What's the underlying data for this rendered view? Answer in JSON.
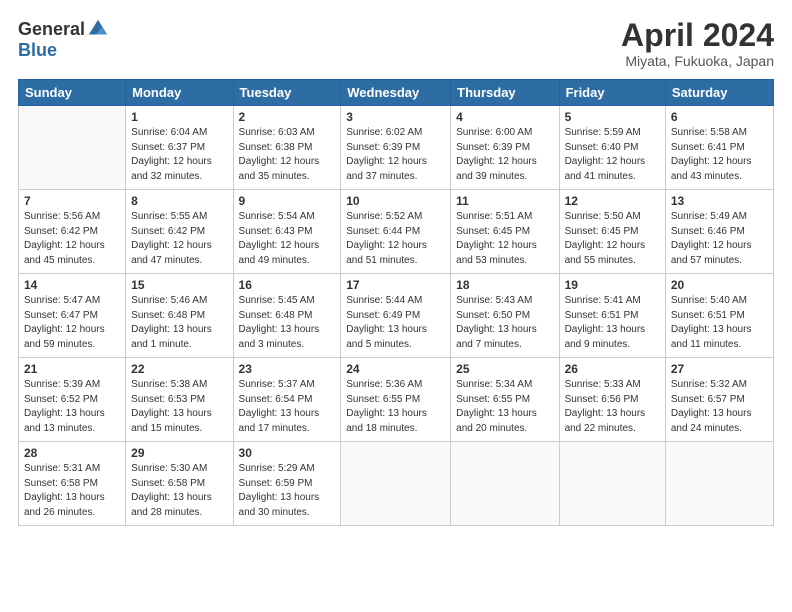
{
  "header": {
    "logo_general": "General",
    "logo_blue": "Blue",
    "title": "April 2024",
    "location": "Miyata, Fukuoka, Japan"
  },
  "weekdays": [
    "Sunday",
    "Monday",
    "Tuesday",
    "Wednesday",
    "Thursday",
    "Friday",
    "Saturday"
  ],
  "weeks": [
    [
      {
        "day": "",
        "empty": true
      },
      {
        "day": "1",
        "sunrise": "6:04 AM",
        "sunset": "6:37 PM",
        "daylight": "12 hours and 32 minutes."
      },
      {
        "day": "2",
        "sunrise": "6:03 AM",
        "sunset": "6:38 PM",
        "daylight": "12 hours and 35 minutes."
      },
      {
        "day": "3",
        "sunrise": "6:02 AM",
        "sunset": "6:39 PM",
        "daylight": "12 hours and 37 minutes."
      },
      {
        "day": "4",
        "sunrise": "6:00 AM",
        "sunset": "6:39 PM",
        "daylight": "12 hours and 39 minutes."
      },
      {
        "day": "5",
        "sunrise": "5:59 AM",
        "sunset": "6:40 PM",
        "daylight": "12 hours and 41 minutes."
      },
      {
        "day": "6",
        "sunrise": "5:58 AM",
        "sunset": "6:41 PM",
        "daylight": "12 hours and 43 minutes."
      }
    ],
    [
      {
        "day": "7",
        "sunrise": "5:56 AM",
        "sunset": "6:42 PM",
        "daylight": "12 hours and 45 minutes."
      },
      {
        "day": "8",
        "sunrise": "5:55 AM",
        "sunset": "6:42 PM",
        "daylight": "12 hours and 47 minutes."
      },
      {
        "day": "9",
        "sunrise": "5:54 AM",
        "sunset": "6:43 PM",
        "daylight": "12 hours and 49 minutes."
      },
      {
        "day": "10",
        "sunrise": "5:52 AM",
        "sunset": "6:44 PM",
        "daylight": "12 hours and 51 minutes."
      },
      {
        "day": "11",
        "sunrise": "5:51 AM",
        "sunset": "6:45 PM",
        "daylight": "12 hours and 53 minutes."
      },
      {
        "day": "12",
        "sunrise": "5:50 AM",
        "sunset": "6:45 PM",
        "daylight": "12 hours and 55 minutes."
      },
      {
        "day": "13",
        "sunrise": "5:49 AM",
        "sunset": "6:46 PM",
        "daylight": "12 hours and 57 minutes."
      }
    ],
    [
      {
        "day": "14",
        "sunrise": "5:47 AM",
        "sunset": "6:47 PM",
        "daylight": "12 hours and 59 minutes."
      },
      {
        "day": "15",
        "sunrise": "5:46 AM",
        "sunset": "6:48 PM",
        "daylight": "13 hours and 1 minute."
      },
      {
        "day": "16",
        "sunrise": "5:45 AM",
        "sunset": "6:48 PM",
        "daylight": "13 hours and 3 minutes."
      },
      {
        "day": "17",
        "sunrise": "5:44 AM",
        "sunset": "6:49 PM",
        "daylight": "13 hours and 5 minutes."
      },
      {
        "day": "18",
        "sunrise": "5:43 AM",
        "sunset": "6:50 PM",
        "daylight": "13 hours and 7 minutes."
      },
      {
        "day": "19",
        "sunrise": "5:41 AM",
        "sunset": "6:51 PM",
        "daylight": "13 hours and 9 minutes."
      },
      {
        "day": "20",
        "sunrise": "5:40 AM",
        "sunset": "6:51 PM",
        "daylight": "13 hours and 11 minutes."
      }
    ],
    [
      {
        "day": "21",
        "sunrise": "5:39 AM",
        "sunset": "6:52 PM",
        "daylight": "13 hours and 13 minutes."
      },
      {
        "day": "22",
        "sunrise": "5:38 AM",
        "sunset": "6:53 PM",
        "daylight": "13 hours and 15 minutes."
      },
      {
        "day": "23",
        "sunrise": "5:37 AM",
        "sunset": "6:54 PM",
        "daylight": "13 hours and 17 minutes."
      },
      {
        "day": "24",
        "sunrise": "5:36 AM",
        "sunset": "6:55 PM",
        "daylight": "13 hours and 18 minutes."
      },
      {
        "day": "25",
        "sunrise": "5:34 AM",
        "sunset": "6:55 PM",
        "daylight": "13 hours and 20 minutes."
      },
      {
        "day": "26",
        "sunrise": "5:33 AM",
        "sunset": "6:56 PM",
        "daylight": "13 hours and 22 minutes."
      },
      {
        "day": "27",
        "sunrise": "5:32 AM",
        "sunset": "6:57 PM",
        "daylight": "13 hours and 24 minutes."
      }
    ],
    [
      {
        "day": "28",
        "sunrise": "5:31 AM",
        "sunset": "6:58 PM",
        "daylight": "13 hours and 26 minutes."
      },
      {
        "day": "29",
        "sunrise": "5:30 AM",
        "sunset": "6:58 PM",
        "daylight": "13 hours and 28 minutes."
      },
      {
        "day": "30",
        "sunrise": "5:29 AM",
        "sunset": "6:59 PM",
        "daylight": "13 hours and 30 minutes."
      },
      {
        "day": "",
        "empty": true
      },
      {
        "day": "",
        "empty": true
      },
      {
        "day": "",
        "empty": true
      },
      {
        "day": "",
        "empty": true
      }
    ]
  ]
}
